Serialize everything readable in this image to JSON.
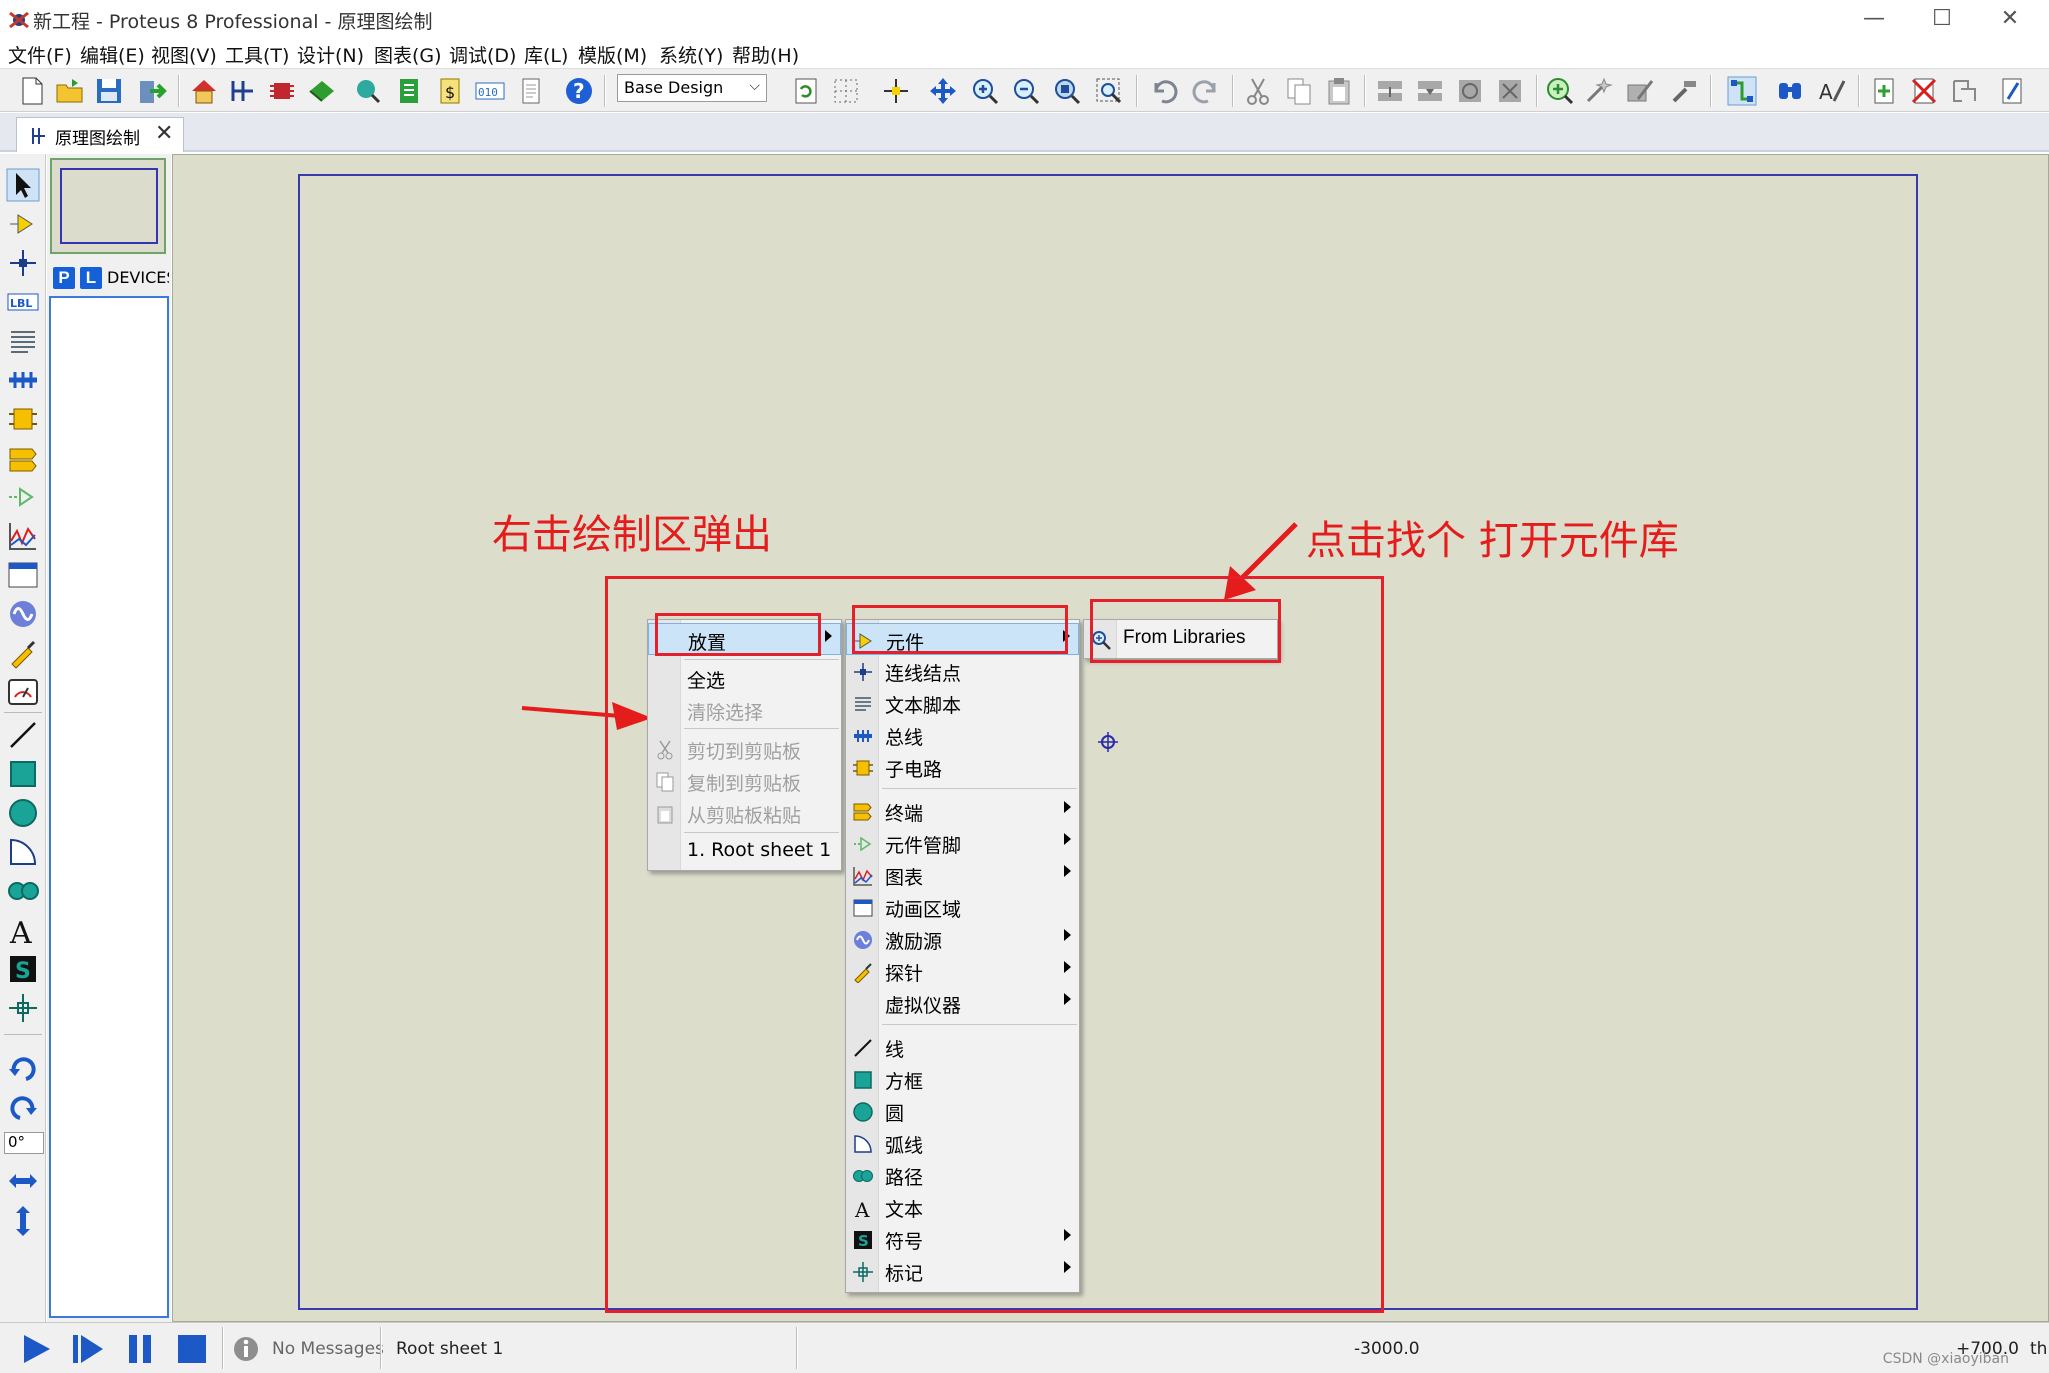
{
  "window": {
    "title": "新工程 - Proteus 8 Professional - 原理图绘制",
    "controls": [
      "—",
      "☐",
      "✕"
    ]
  },
  "menubar": [
    "文件(F)",
    "编辑(E)",
    "视图(V)",
    "工具(T)",
    "设计(N)",
    "图表(G)",
    "调试(D)",
    "库(L)",
    "模版(M)",
    "系统(Y)",
    "帮助(H)"
  ],
  "toolbar": {
    "design_select": "Base Design"
  },
  "tab": {
    "label": "原理图绘制",
    "close": "✕"
  },
  "left_tools": {
    "rotation_value": "0°"
  },
  "object_selector": {
    "p_button": "P",
    "l_button": "L",
    "label": "DEVICES"
  },
  "annotations": {
    "left_note": "右击绘制区弹出",
    "right_note": "点击找个 打开元件库"
  },
  "context_menu": {
    "items": [
      {
        "label": "放置",
        "has_sub": true,
        "enabled": true,
        "highlighted": true
      },
      {
        "label": "全选",
        "has_sub": false,
        "enabled": true
      },
      {
        "label": "清除选择",
        "has_sub": false,
        "enabled": false
      },
      {
        "label": "剪切到剪贴板",
        "has_sub": false,
        "enabled": false
      },
      {
        "label": "复制到剪贴板",
        "has_sub": false,
        "enabled": false
      },
      {
        "label": "从剪贴板粘贴",
        "has_sub": false,
        "enabled": false
      },
      {
        "label": "1. Root sheet 1",
        "has_sub": false,
        "enabled": true
      }
    ]
  },
  "place_submenu": {
    "items": [
      {
        "label": "元件",
        "icon": "component-icon",
        "has_sub": true,
        "highlighted": true
      },
      {
        "label": "连线结点",
        "icon": "junction-icon",
        "has_sub": false
      },
      {
        "label": "文本脚本",
        "icon": "script-icon",
        "has_sub": false
      },
      {
        "label": "总线",
        "icon": "bus-icon",
        "has_sub": false
      },
      {
        "label": "子电路",
        "icon": "subcircuit-icon",
        "has_sub": false
      },
      {
        "label": "终端",
        "icon": "terminal-icon",
        "has_sub": true
      },
      {
        "label": "元件管脚",
        "icon": "pin-icon",
        "has_sub": true
      },
      {
        "label": "图表",
        "icon": "graph-icon",
        "has_sub": true
      },
      {
        "label": "动画区域",
        "icon": "animation-icon",
        "has_sub": false
      },
      {
        "label": "激励源",
        "icon": "generator-icon",
        "has_sub": true
      },
      {
        "label": "探针",
        "icon": "probe-icon",
        "has_sub": true
      },
      {
        "label": "虚拟仪器",
        "icon": "instrument-icon",
        "has_sub": true
      },
      {
        "label": "线",
        "icon": "line-icon",
        "has_sub": false
      },
      {
        "label": "方框",
        "icon": "box-icon",
        "has_sub": false
      },
      {
        "label": "圆",
        "icon": "circle-icon",
        "has_sub": false
      },
      {
        "label": "弧线",
        "icon": "arc-icon",
        "has_sub": false
      },
      {
        "label": "路径",
        "icon": "path-icon",
        "has_sub": false
      },
      {
        "label": "文本",
        "icon": "text-icon",
        "has_sub": false
      },
      {
        "label": "符号",
        "icon": "symbol-icon",
        "has_sub": true
      },
      {
        "label": "标记",
        "icon": "marker-icon",
        "has_sub": true
      }
    ]
  },
  "libraries_submenu": {
    "label": "From Libraries"
  },
  "statusbar": {
    "messages": "No Messages",
    "sheet": "Root sheet 1",
    "coord_x": "-3000.0",
    "coord_y": "+700.0",
    "unit": "th",
    "watermark": "CSDN @xiaoyiban"
  },
  "colors": {
    "annotation_red": "#e41c1c",
    "canvas_bg": "#ddddcc",
    "sheet_border": "#3a3ab0",
    "highlight": "#cce4f7"
  }
}
